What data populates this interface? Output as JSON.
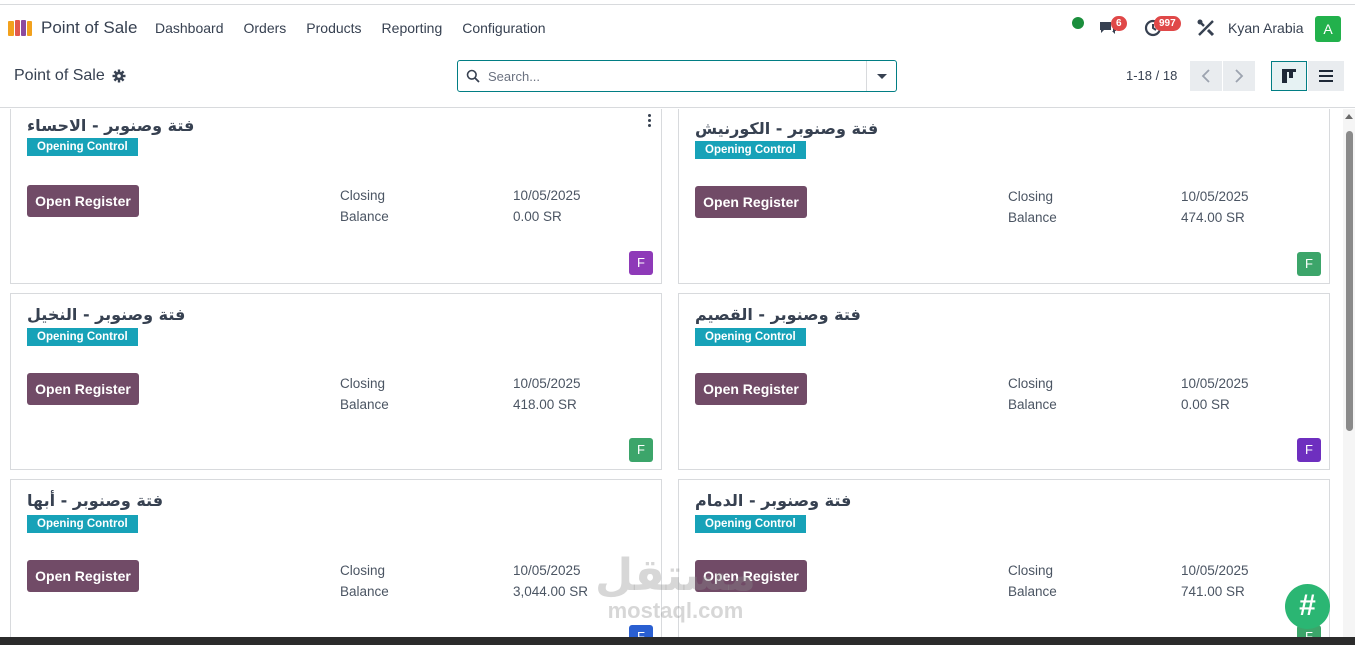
{
  "app": {
    "name": "Point of Sale"
  },
  "menu": [
    "Dashboard",
    "Orders",
    "Products",
    "Reporting",
    "Configuration"
  ],
  "systray": {
    "messages_count": "6",
    "activities_count": "997",
    "company": "Kyan Arabia",
    "avatar_letter": "A"
  },
  "breadcrumb": {
    "title": "Point of Sale"
  },
  "search": {
    "placeholder": "Search..."
  },
  "pager": {
    "value": "1-18 / 18"
  },
  "cards": [
    {
      "title": "فتة وصنوبر - الاحساء",
      "tag": "Opening Control",
      "button": "Open Register",
      "closing_label": "Closing",
      "closing_date": "10/05/2025",
      "balance_label": "Balance",
      "balance": "0.00 SR",
      "avatar": "F",
      "avatar_color": "#8e3ab8"
    },
    {
      "title": "فتة وصنوبر - الكورنيش",
      "tag": "Opening Control",
      "button": "Open Register",
      "closing_label": "Closing",
      "closing_date": "10/05/2025",
      "balance_label": "Balance",
      "balance": "474.00 SR",
      "avatar": "F",
      "avatar_color": "#3ca56a"
    },
    {
      "title": "فتة وصنوبر - النخيل",
      "tag": "Opening Control",
      "button": "Open Register",
      "closing_label": "Closing",
      "closing_date": "10/05/2025",
      "balance_label": "Balance",
      "balance": "418.00 SR",
      "avatar": "F",
      "avatar_color": "#3ca56a"
    },
    {
      "title": "فتة وصنوبر - القصيم",
      "tag": "Opening Control",
      "button": "Open Register",
      "closing_label": "Closing",
      "closing_date": "10/05/2025",
      "balance_label": "Balance",
      "balance": "0.00 SR",
      "avatar": "F",
      "avatar_color": "#6e2fbf"
    },
    {
      "title": "فتة وصنوبر - أبها",
      "tag": "Opening Control",
      "button": "Open Register",
      "closing_label": "Closing",
      "closing_date": "10/05/2025",
      "balance_label": "Balance",
      "balance": "3,044.00 SR",
      "avatar": "F",
      "avatar_color": "#2a5fd1"
    },
    {
      "title": "فتة وصنوبر - الدمام",
      "tag": "Opening Control",
      "button": "Open Register",
      "closing_label": "Closing",
      "closing_date": "10/05/2025",
      "balance_label": "Balance",
      "balance": "741.00 SR",
      "avatar": "F",
      "avatar_color": "#3ca56a"
    }
  ],
  "watermark": {
    "arabic": "مستقل",
    "latin": "mostaql.com"
  },
  "fab": {
    "label": "#"
  },
  "colors": {
    "primary": "#714b67",
    "tag": "#17a2b8",
    "accent": "#017e84"
  }
}
